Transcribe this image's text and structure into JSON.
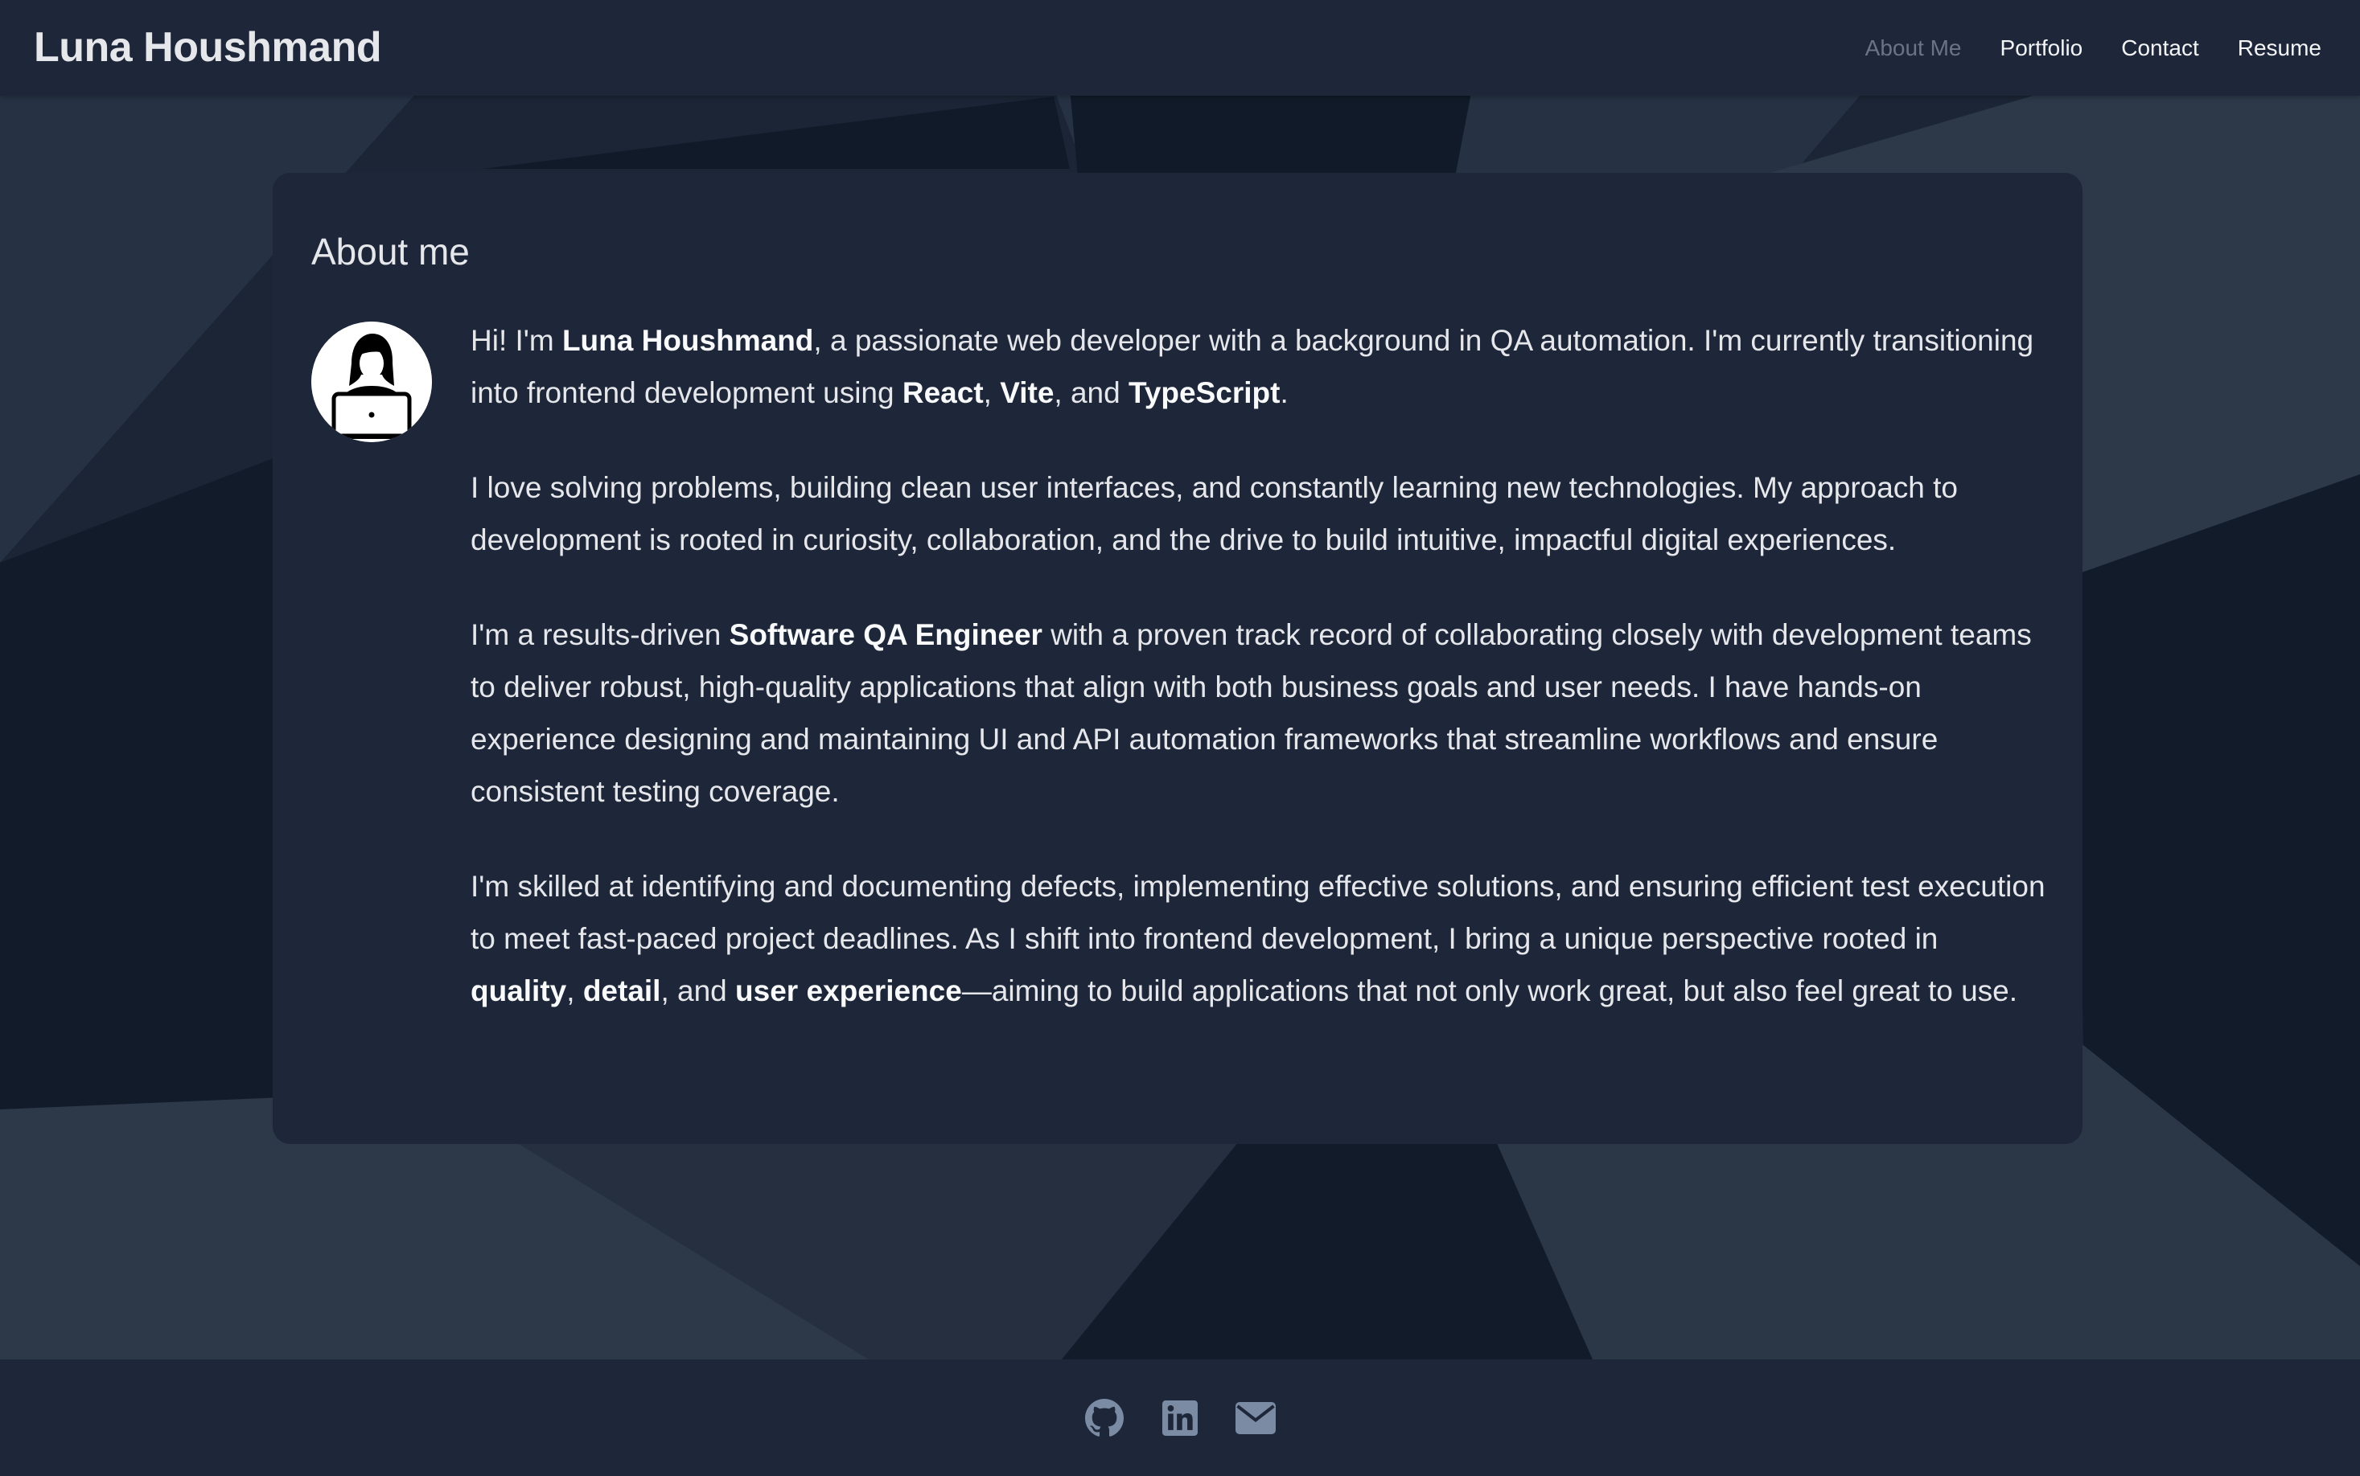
{
  "header": {
    "brand": "Luna Houshmand",
    "nav": [
      {
        "label": "About Me",
        "active": true
      },
      {
        "label": "Portfolio",
        "active": false
      },
      {
        "label": "Contact",
        "active": false
      },
      {
        "label": "Resume",
        "active": false
      }
    ]
  },
  "about": {
    "title": "About me",
    "avatar_icon": "woman-with-laptop-icon",
    "p1": {
      "t1": "Hi! I'm ",
      "name": "Luna Houshmand",
      "t2": ", a passionate web developer with a background in QA automation. I'm currently transitioning into frontend development using ",
      "react": "React",
      "t3": ", ",
      "vite": "Vite",
      "t4": ", and ",
      "ts": "TypeScript",
      "t5": "."
    },
    "p2": "I love solving problems, building clean user interfaces, and constantly learning new technologies. My approach to development is rooted in curiosity, collaboration, and the drive to build intuitive, impactful digital experiences.",
    "p3": {
      "t1": "I'm a results-driven ",
      "role": "Software QA Engineer",
      "t2": " with a proven track record of collaborating closely with development teams to deliver robust, high-quality applications that align with both business goals and user needs. I have hands-on experience designing and maintaining UI and API automation frameworks that streamline workflows and ensure consistent testing coverage."
    },
    "p4": {
      "t1": "I'm skilled at identifying and documenting defects, implementing effective solutions, and ensuring efficient test execution to meet fast-paced project deadlines. As I shift into frontend development, I bring a unique perspective rooted in ",
      "quality": "quality",
      "t2": ", ",
      "detail": "detail",
      "t3": ", and ",
      "ux": "user experience",
      "t4": "—aiming to build applications that not only work great, but also feel great to use."
    }
  },
  "footer": {
    "icons": [
      "github-icon",
      "linkedin-icon",
      "email-icon"
    ]
  },
  "colors": {
    "background": "#1b2535",
    "panel": "#1e2639",
    "text": "#e5e7eb",
    "nav_active": "#6b7487",
    "footer_icon": "#7a8ba3"
  }
}
